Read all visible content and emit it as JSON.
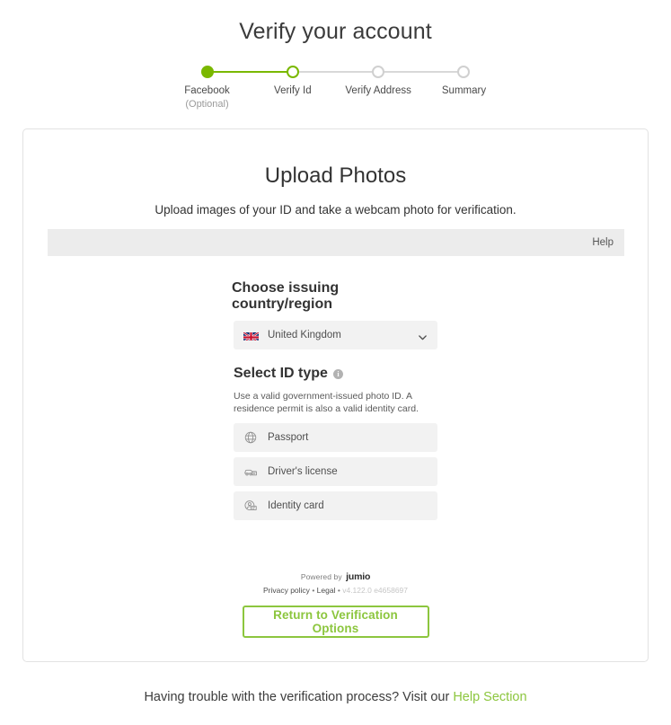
{
  "page": {
    "title": "Verify your account"
  },
  "stepper": {
    "steps": [
      {
        "label": "Facebook",
        "sub": "(Optional)",
        "state": "completed"
      },
      {
        "label": "Verify Id",
        "sub": "",
        "state": "current"
      },
      {
        "label": "Verify Address",
        "sub": "",
        "state": "upcoming"
      },
      {
        "label": "Summary",
        "sub": "",
        "state": "upcoming"
      }
    ],
    "accent_color": "#7ab800",
    "inactive_color": "#d0d0d0"
  },
  "card": {
    "title": "Upload Photos",
    "subtitle": "Upload images of your ID and take a webcam photo for verification.",
    "help_bar": {
      "link_label": "Help"
    },
    "country": {
      "heading": "Choose issuing country/region",
      "selected": "United Kingdom",
      "flag": "united-kingdom-flag",
      "chevron": "chevron-down-icon"
    },
    "id_type": {
      "heading": "Select ID type",
      "info_icon": "info-icon",
      "info_glyph": "i",
      "description": "Use a valid government-issued photo ID. A residence permit is also a valid identity card.",
      "options": [
        {
          "label": "Passport",
          "icon": "passport-globe-icon"
        },
        {
          "label": "Driver's license",
          "icon": "drivers-license-car-icon"
        },
        {
          "label": "Identity card",
          "icon": "identity-card-icon"
        }
      ]
    },
    "branding": {
      "powered_by": "Powered by",
      "brand": "jumio",
      "privacy_label": "Privacy policy",
      "separator": "•",
      "legal_label": "Legal",
      "version": "v4.122.0 e4658697"
    },
    "return_button": {
      "label": "Return to Verification Options",
      "color": "#8cc63e"
    }
  },
  "bottom_help": {
    "text": "Having trouble with the verification process? Visit our",
    "link_label": "Help Section",
    "link_color": "#8cc63e"
  }
}
